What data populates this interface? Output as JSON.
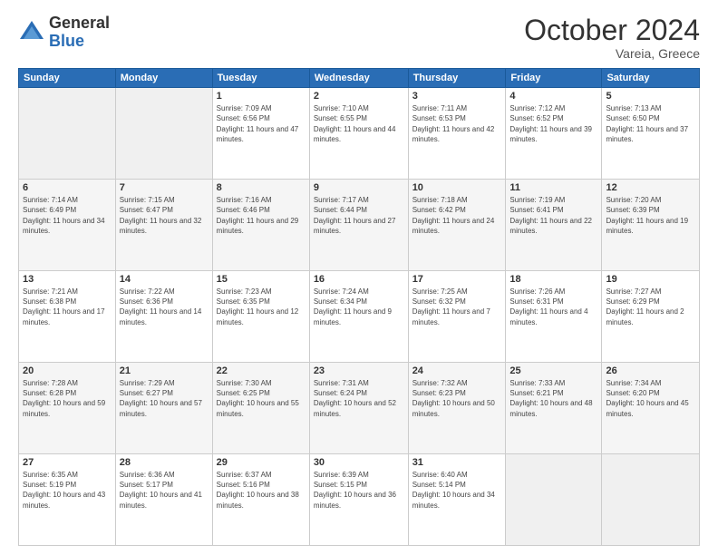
{
  "header": {
    "logo_general": "General",
    "logo_blue": "Blue",
    "month_title": "October 2024",
    "subtitle": "Vareia, Greece"
  },
  "weekdays": [
    "Sunday",
    "Monday",
    "Tuesday",
    "Wednesday",
    "Thursday",
    "Friday",
    "Saturday"
  ],
  "weeks": [
    [
      {
        "day": "",
        "empty": true
      },
      {
        "day": "",
        "empty": true
      },
      {
        "day": "1",
        "sunrise": "7:09 AM",
        "sunset": "6:56 PM",
        "daylight": "11 hours and 47 minutes."
      },
      {
        "day": "2",
        "sunrise": "7:10 AM",
        "sunset": "6:55 PM",
        "daylight": "11 hours and 44 minutes."
      },
      {
        "day": "3",
        "sunrise": "7:11 AM",
        "sunset": "6:53 PM",
        "daylight": "11 hours and 42 minutes."
      },
      {
        "day": "4",
        "sunrise": "7:12 AM",
        "sunset": "6:52 PM",
        "daylight": "11 hours and 39 minutes."
      },
      {
        "day": "5",
        "sunrise": "7:13 AM",
        "sunset": "6:50 PM",
        "daylight": "11 hours and 37 minutes."
      }
    ],
    [
      {
        "day": "6",
        "sunrise": "7:14 AM",
        "sunset": "6:49 PM",
        "daylight": "11 hours and 34 minutes."
      },
      {
        "day": "7",
        "sunrise": "7:15 AM",
        "sunset": "6:47 PM",
        "daylight": "11 hours and 32 minutes."
      },
      {
        "day": "8",
        "sunrise": "7:16 AM",
        "sunset": "6:46 PM",
        "daylight": "11 hours and 29 minutes."
      },
      {
        "day": "9",
        "sunrise": "7:17 AM",
        "sunset": "6:44 PM",
        "daylight": "11 hours and 27 minutes."
      },
      {
        "day": "10",
        "sunrise": "7:18 AM",
        "sunset": "6:42 PM",
        "daylight": "11 hours and 24 minutes."
      },
      {
        "day": "11",
        "sunrise": "7:19 AM",
        "sunset": "6:41 PM",
        "daylight": "11 hours and 22 minutes."
      },
      {
        "day": "12",
        "sunrise": "7:20 AM",
        "sunset": "6:39 PM",
        "daylight": "11 hours and 19 minutes."
      }
    ],
    [
      {
        "day": "13",
        "sunrise": "7:21 AM",
        "sunset": "6:38 PM",
        "daylight": "11 hours and 17 minutes."
      },
      {
        "day": "14",
        "sunrise": "7:22 AM",
        "sunset": "6:36 PM",
        "daylight": "11 hours and 14 minutes."
      },
      {
        "day": "15",
        "sunrise": "7:23 AM",
        "sunset": "6:35 PM",
        "daylight": "11 hours and 12 minutes."
      },
      {
        "day": "16",
        "sunrise": "7:24 AM",
        "sunset": "6:34 PM",
        "daylight": "11 hours and 9 minutes."
      },
      {
        "day": "17",
        "sunrise": "7:25 AM",
        "sunset": "6:32 PM",
        "daylight": "11 hours and 7 minutes."
      },
      {
        "day": "18",
        "sunrise": "7:26 AM",
        "sunset": "6:31 PM",
        "daylight": "11 hours and 4 minutes."
      },
      {
        "day": "19",
        "sunrise": "7:27 AM",
        "sunset": "6:29 PM",
        "daylight": "11 hours and 2 minutes."
      }
    ],
    [
      {
        "day": "20",
        "sunrise": "7:28 AM",
        "sunset": "6:28 PM",
        "daylight": "10 hours and 59 minutes."
      },
      {
        "day": "21",
        "sunrise": "7:29 AM",
        "sunset": "6:27 PM",
        "daylight": "10 hours and 57 minutes."
      },
      {
        "day": "22",
        "sunrise": "7:30 AM",
        "sunset": "6:25 PM",
        "daylight": "10 hours and 55 minutes."
      },
      {
        "day": "23",
        "sunrise": "7:31 AM",
        "sunset": "6:24 PM",
        "daylight": "10 hours and 52 minutes."
      },
      {
        "day": "24",
        "sunrise": "7:32 AM",
        "sunset": "6:23 PM",
        "daylight": "10 hours and 50 minutes."
      },
      {
        "day": "25",
        "sunrise": "7:33 AM",
        "sunset": "6:21 PM",
        "daylight": "10 hours and 48 minutes."
      },
      {
        "day": "26",
        "sunrise": "7:34 AM",
        "sunset": "6:20 PM",
        "daylight": "10 hours and 45 minutes."
      }
    ],
    [
      {
        "day": "27",
        "sunrise": "6:35 AM",
        "sunset": "5:19 PM",
        "daylight": "10 hours and 43 minutes."
      },
      {
        "day": "28",
        "sunrise": "6:36 AM",
        "sunset": "5:17 PM",
        "daylight": "10 hours and 41 minutes."
      },
      {
        "day": "29",
        "sunrise": "6:37 AM",
        "sunset": "5:16 PM",
        "daylight": "10 hours and 38 minutes."
      },
      {
        "day": "30",
        "sunrise": "6:39 AM",
        "sunset": "5:15 PM",
        "daylight": "10 hours and 36 minutes."
      },
      {
        "day": "31",
        "sunrise": "6:40 AM",
        "sunset": "5:14 PM",
        "daylight": "10 hours and 34 minutes."
      },
      {
        "day": "",
        "empty": true
      },
      {
        "day": "",
        "empty": true
      }
    ]
  ]
}
